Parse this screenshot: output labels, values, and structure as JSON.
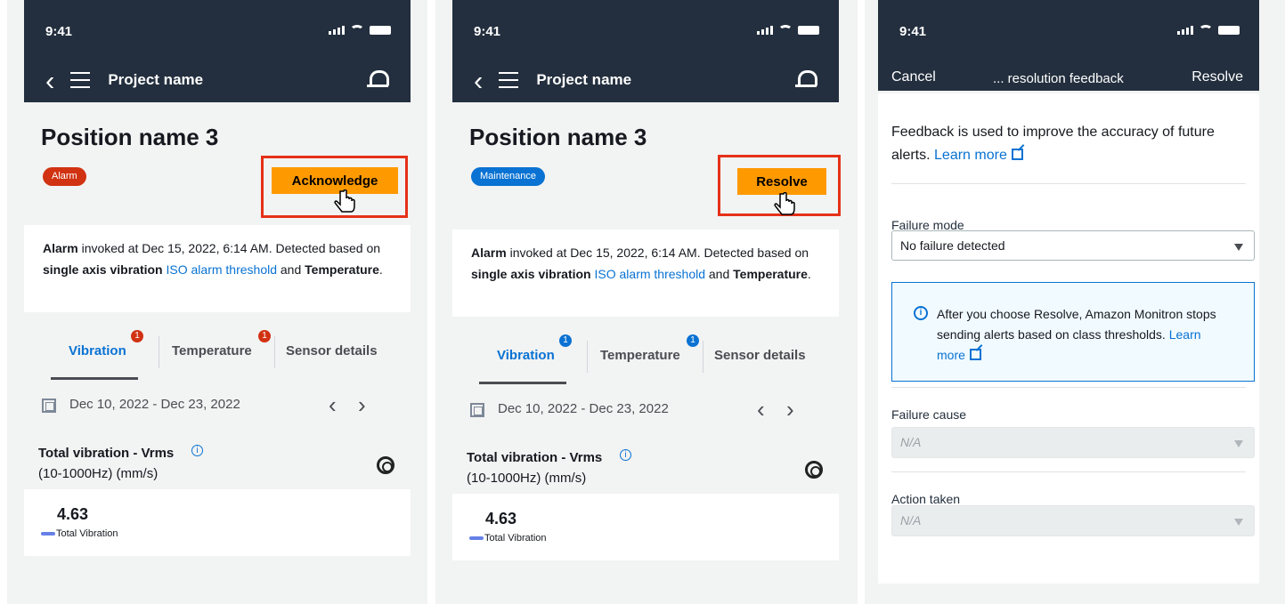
{
  "screens": [
    {
      "status_time": "9:41",
      "project_name": "Project name",
      "position_title": "Position name 3",
      "status_badge": "Alarm",
      "action_label": "Acknowledge",
      "message": {
        "alarm": "Alarm",
        "invoked": " invoked at Dec 15, 2022, 6:14 AM. Detected based on ",
        "single_axis": "single axis vibration",
        "link": "ISO alarm threshold",
        "and": " and ",
        "temperature": "Temperature",
        "period": "."
      },
      "tabs": [
        {
          "label": "Vibration",
          "badge": "1"
        },
        {
          "label": "Temperature",
          "badge": "1"
        },
        {
          "label": "Sensor details"
        }
      ],
      "date_range": "Dec 10, 2022 - Dec 23, 2022",
      "metric_title": "Total vibration - Vrms",
      "metric_subtitle": "(10-1000Hz) (mm/s)",
      "metric_value": "4.63",
      "legend_label": "Total Vibration"
    },
    {
      "status_time": "9:41",
      "project_name": "Project name",
      "position_title": "Position name 3",
      "status_badge": "Maintenance",
      "action_label": "Resolve",
      "message": {
        "alarm": "Alarm",
        "invoked": " invoked at Dec 15, 2022, 6:14 AM. Detected based on ",
        "single_axis": "single axis vibration",
        "link": "ISO alarm threshold",
        "and": " and ",
        "temperature": "Temperature",
        "period": "."
      },
      "tabs": [
        {
          "label": "Vibration",
          "badge": "1"
        },
        {
          "label": "Temperature",
          "badge": "1"
        },
        {
          "label": "Sensor details"
        }
      ],
      "date_range": "Dec 10, 2022 - Dec 23, 2022",
      "metric_title": "Total vibration - Vrms",
      "metric_subtitle": "(10-1000Hz) (mm/s)",
      "metric_value": "4.63",
      "legend_label": "Total Vibration"
    }
  ],
  "feedback": {
    "status_time": "9:41",
    "cancel_label": "Cancel",
    "title": "... resolution feedback",
    "resolve_label": "Resolve",
    "description": "Feedback is used to improve the accuracy of future alerts.",
    "learn_more": "Learn more",
    "failure_mode_label": "Failure mode",
    "failure_mode_value": "No failure detected",
    "alert_text": "After you choose Resolve, Amazon Monitron stops sending alerts based on class thresholds.",
    "alert_learn_more": "Learn more",
    "failure_cause_label": "Failure cause",
    "failure_cause_value": "N/A",
    "action_taken_label": "Action taken",
    "action_taken_value": "N/A"
  },
  "colors": {
    "nav_background": "#232f3e",
    "alarm_badge": "#d13212",
    "maintenance_badge": "#0972d3",
    "primary_button": "#ff9900",
    "highlight_border": "#e53118",
    "link": "#0972d3"
  },
  "icons": [
    "back-icon",
    "menu-icon",
    "notifications-bell-icon",
    "calendar-icon",
    "info-icon",
    "settings-gear-icon",
    "external-link-icon",
    "pointer-cursor-icon"
  ]
}
